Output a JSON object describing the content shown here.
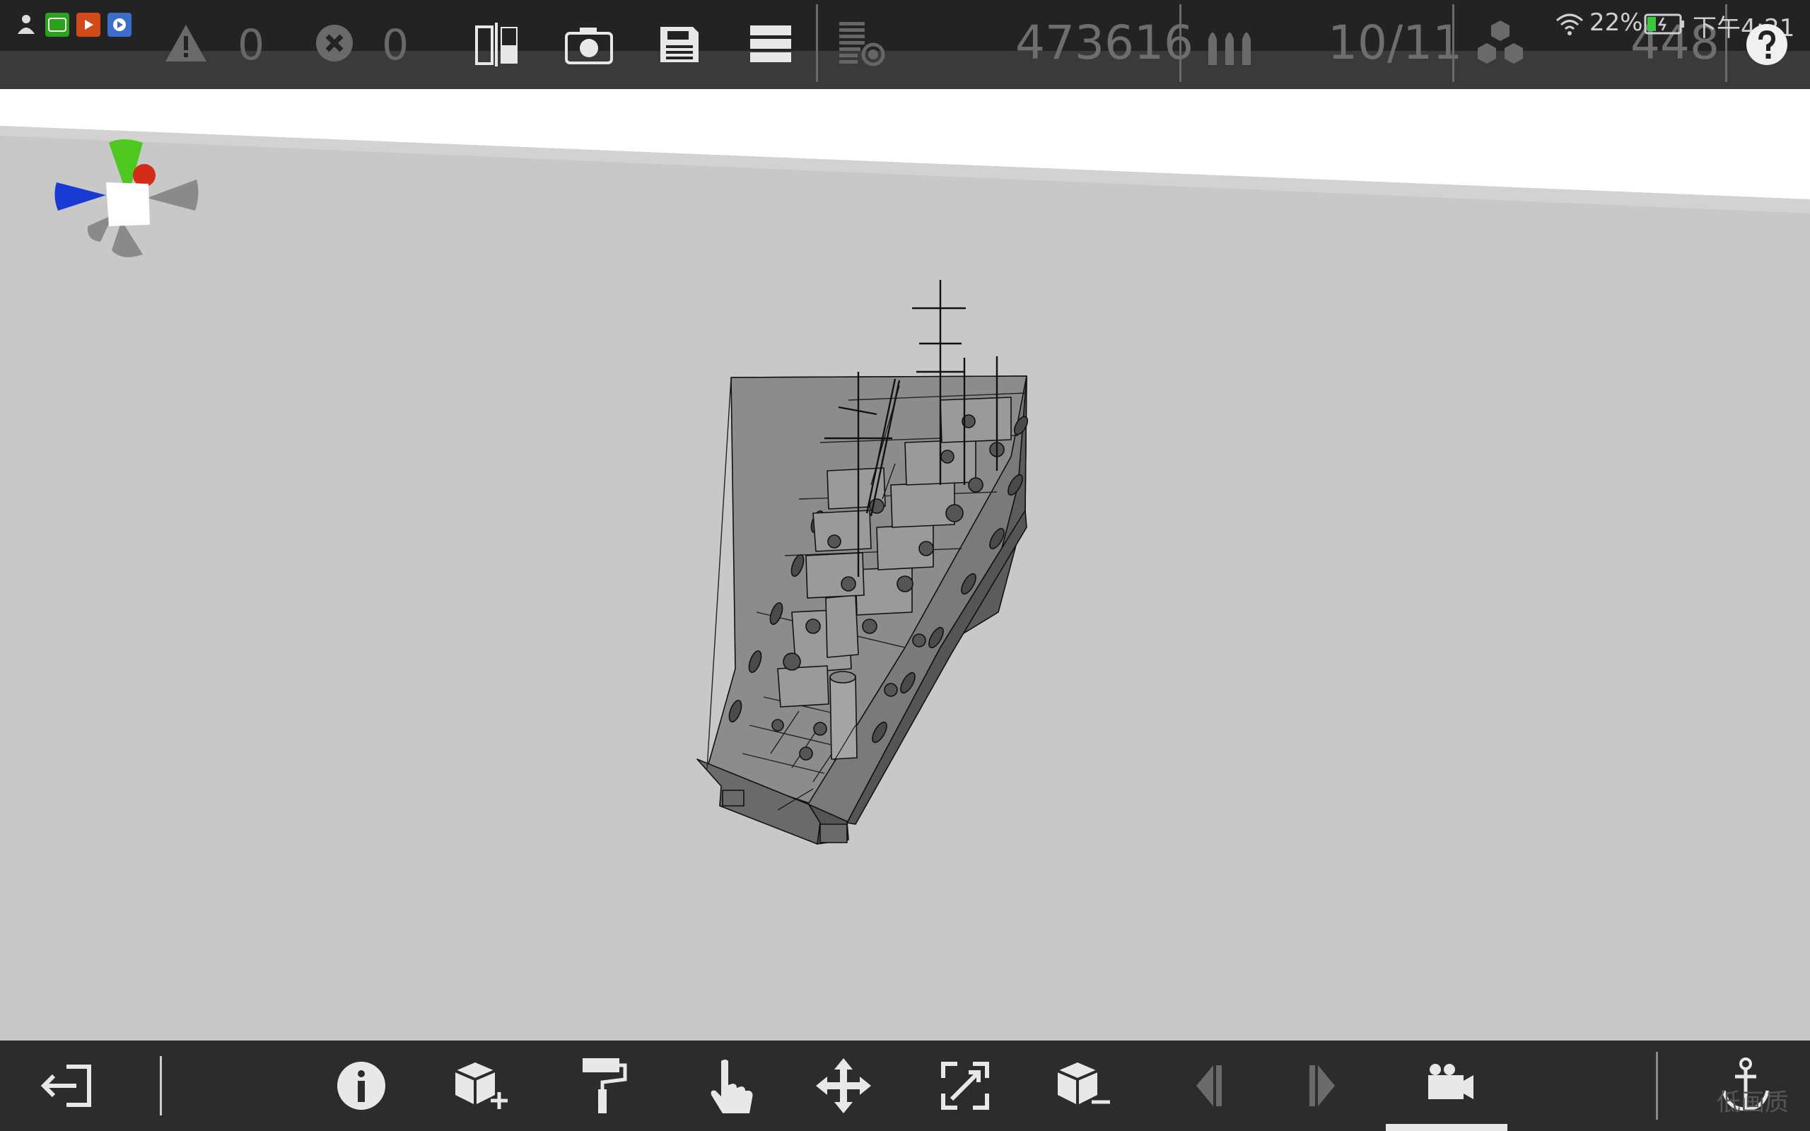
{
  "status_bar": {
    "wifi_icon": "wifi-icon",
    "battery_percent": "22%",
    "time": "下午4:21"
  },
  "top_toolbar": {
    "warnings_count": "0",
    "errors_count": "0",
    "stat_parts": "473616",
    "stat_ammo": "10/11",
    "stat_blocks": "448"
  },
  "bottom_toolbar": {
    "watermark": "低画质"
  },
  "colors": {
    "toolbar_bg": "#232323",
    "viewport_bg": "#c8c8c8",
    "axis_y": "#4ec81e",
    "axis_x": "#d42a1a",
    "axis_z": "#1a3ad4"
  }
}
